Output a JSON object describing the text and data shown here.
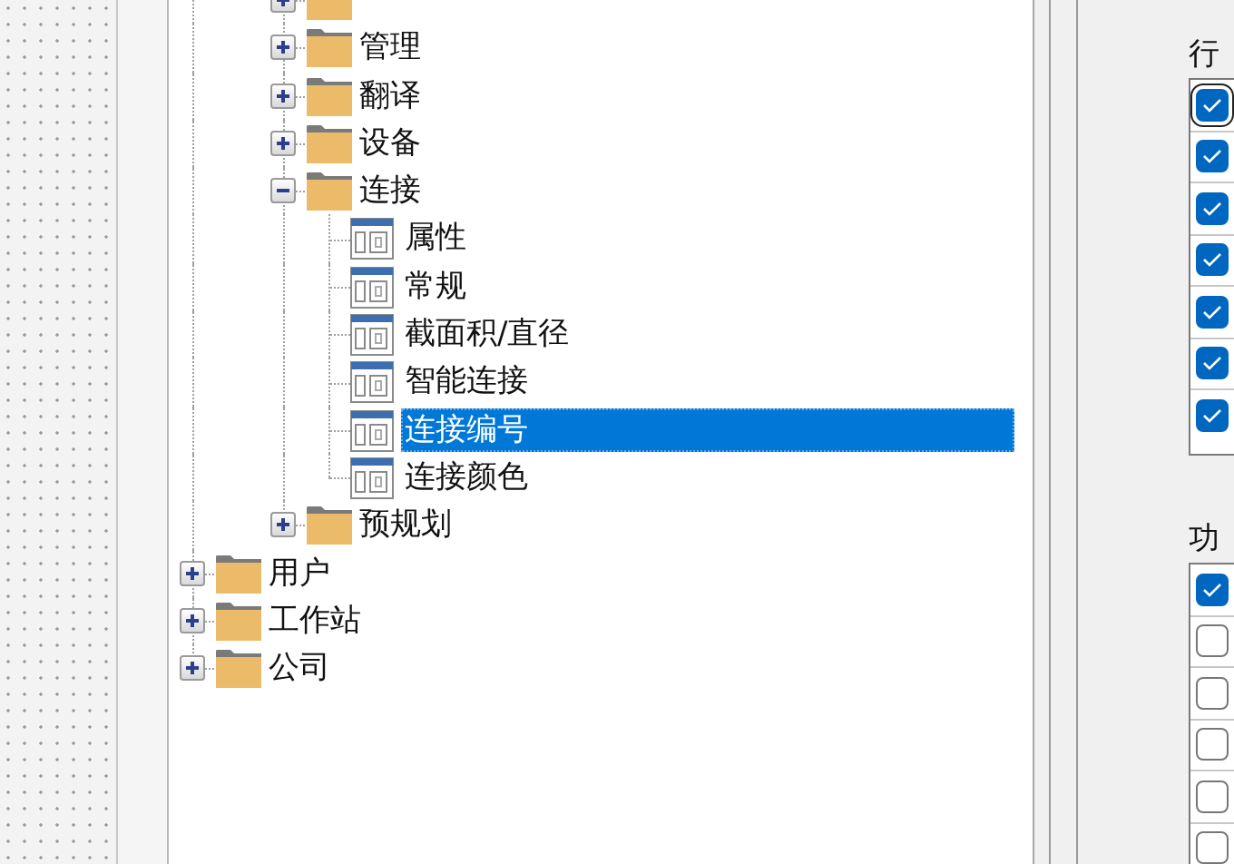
{
  "tree": {
    "nodes": [
      {
        "kind": "folder",
        "expanded": false
      },
      {
        "label": "管理",
        "kind": "folder",
        "expanded": false
      },
      {
        "label": "翻译",
        "kind": "folder",
        "expanded": false
      },
      {
        "label": "设备",
        "kind": "folder",
        "expanded": false
      },
      {
        "label": "连接",
        "kind": "folder",
        "expanded": true,
        "children": [
          {
            "label": "属性",
            "kind": "page",
            "selected": false
          },
          {
            "label": "常规",
            "kind": "page",
            "selected": false
          },
          {
            "label": "截面积/直径",
            "kind": "page",
            "selected": false
          },
          {
            "label": "智能连接",
            "kind": "page",
            "selected": false
          },
          {
            "label": "连接编号",
            "kind": "page",
            "selected": true
          },
          {
            "label": "连接颜色",
            "kind": "page",
            "selected": false
          }
        ]
      },
      {
        "label": "预规划",
        "kind": "folder",
        "expanded": false
      }
    ],
    "roots": [
      {
        "label": "用户",
        "kind": "folder",
        "expanded": false
      },
      {
        "label": "工作站",
        "kind": "folder",
        "expanded": false
      },
      {
        "label": "公司",
        "kind": "folder",
        "expanded": false
      }
    ]
  },
  "industry_group": {
    "label": "行",
    "items": [
      {
        "checked": true
      },
      {
        "checked": true
      },
      {
        "checked": true
      },
      {
        "checked": true
      },
      {
        "checked": true
      },
      {
        "checked": true
      },
      {
        "checked": true
      }
    ]
  },
  "function_group": {
    "label": "功",
    "items": [
      {
        "checked": true
      },
      {
        "checked": false
      },
      {
        "checked": false
      },
      {
        "checked": false
      },
      {
        "checked": false
      },
      {
        "checked": false
      }
    ]
  }
}
